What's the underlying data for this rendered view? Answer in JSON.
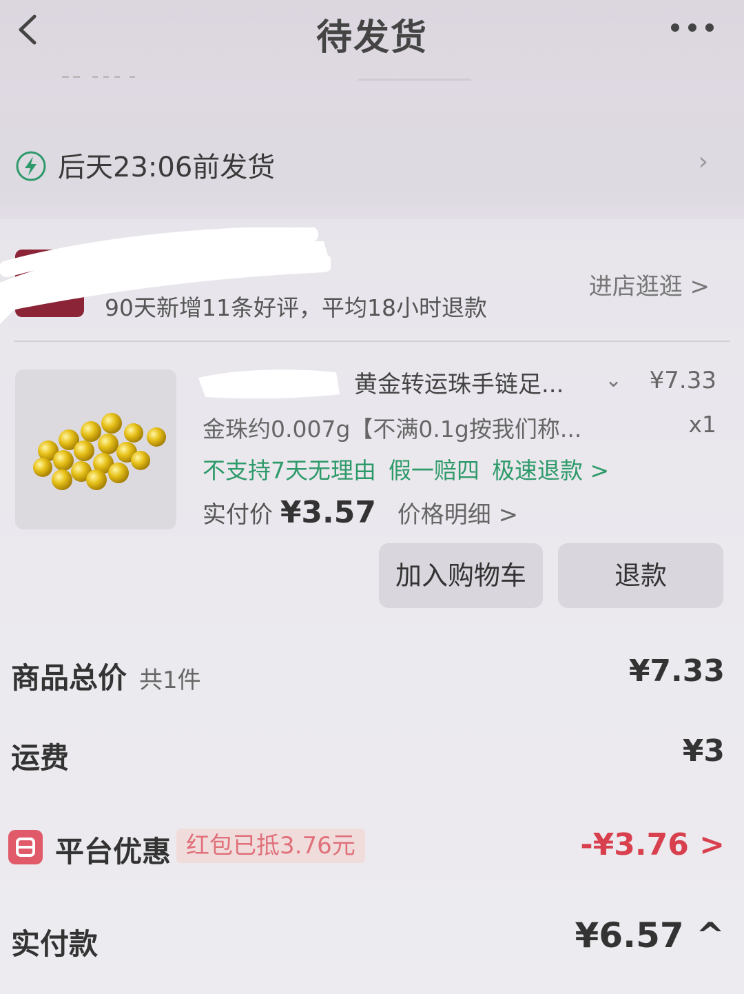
{
  "header": {
    "title": "待发货"
  },
  "shipping": {
    "text": "后天23:06前发货"
  },
  "store": {
    "stats": "90天新增11条好评，平均18小时退款",
    "link": "进店逛逛 >"
  },
  "product": {
    "title": "黄金转运珠手链足...",
    "price": "¥7.33",
    "spec": "金珠约0.007g【不满0.1g按我们称...",
    "quantity": "x1",
    "tags": [
      "不支持7天无理由",
      "假一赔四",
      "极速退款 >"
    ],
    "paid_label": "实付价",
    "paid_amount": "¥3.57",
    "price_detail": "价格明细 >",
    "buttons": {
      "add_cart": "加入购物车",
      "refund": "退款"
    }
  },
  "summary": {
    "goods_total_label": "商品总价",
    "goods_count": "共1件",
    "goods_total": "¥7.33",
    "shipping_label": "运费",
    "shipping_fee": "¥3",
    "platform_discount_label": "平台优惠",
    "discount_tag": "红包已抵3.76元",
    "discount_value": "-¥3.76 >",
    "paid_label": "实付款",
    "paid_value": "¥6.57 ^"
  },
  "colors": {
    "accent_green": "#2e9a6a",
    "discount_red": "#d8404e"
  }
}
